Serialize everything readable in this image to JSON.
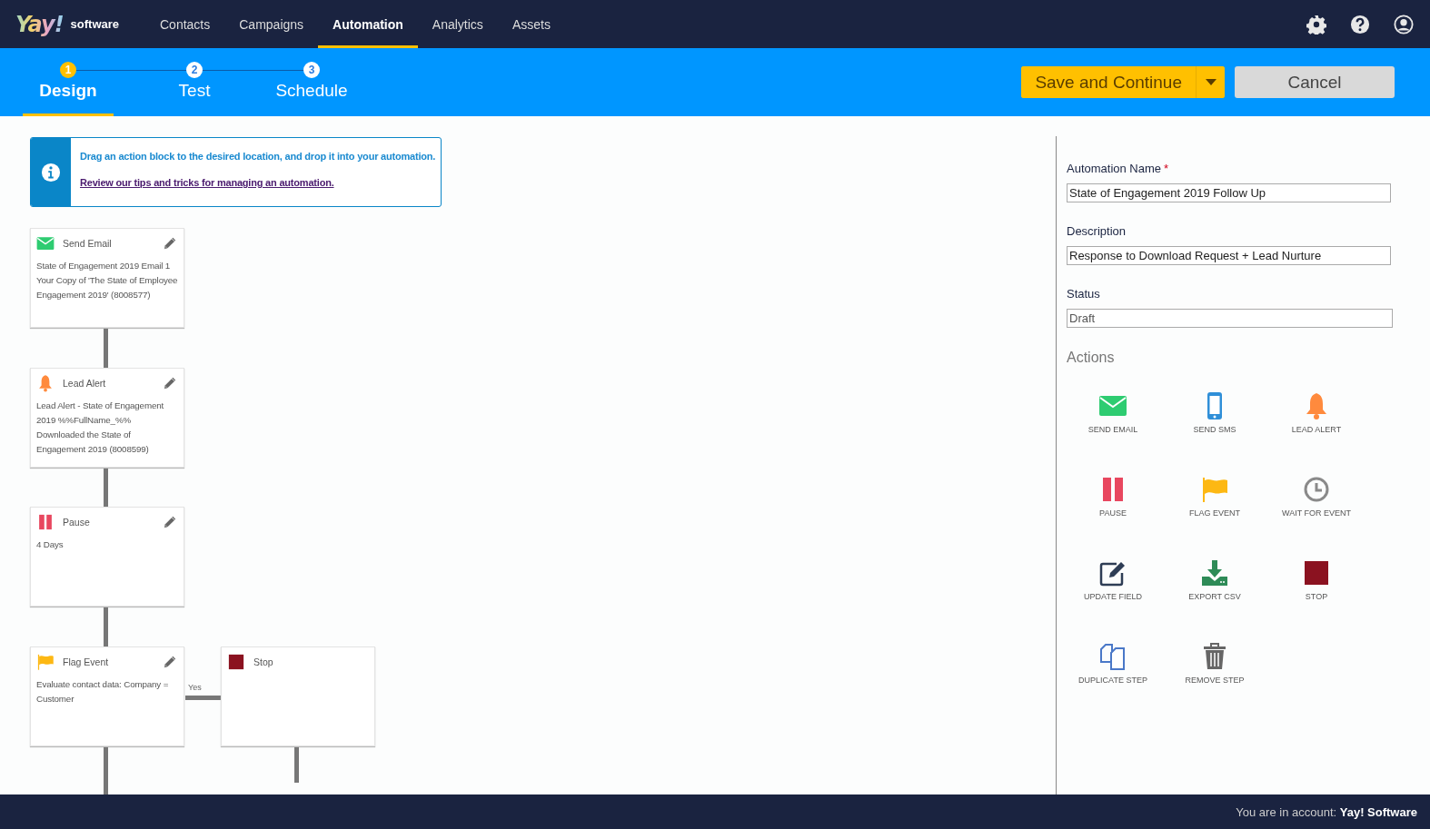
{
  "header": {
    "logo": "Yay!",
    "logo_suffix": "software",
    "nav": [
      {
        "label": "Contacts",
        "selected": false
      },
      {
        "label": "Campaigns",
        "selected": false
      },
      {
        "label": "Automation",
        "selected": true
      },
      {
        "label": "Analytics",
        "selected": false
      },
      {
        "label": "Assets",
        "selected": false
      }
    ]
  },
  "wizard": {
    "steps": [
      {
        "number": "1",
        "label": "Design",
        "selected": true
      },
      {
        "number": "2",
        "label": "Test",
        "selected": false
      },
      {
        "number": "3",
        "label": "Schedule",
        "selected": false
      }
    ],
    "primary_button": "Save and Continue",
    "cancel_button": "Cancel"
  },
  "info": {
    "message": "Drag an action block to the desired location, and drop it into your automation.",
    "link": "Review our tips and tricks for managing an automation."
  },
  "flow": [
    {
      "kind": "email",
      "title": "Send Email",
      "editable": true,
      "text": "State of Engagement 2019 Email 1 Your Copy of 'The State of Employee Engagement 2019' (8008577)"
    },
    {
      "kind": "alert",
      "title": "Lead Alert",
      "editable": true,
      "text": "Lead Alert - State of Engagement 2019 %%FullName_%% Downloaded the State of Engagement 2019 (8008599)"
    },
    {
      "kind": "pause",
      "title": "Pause",
      "editable": true,
      "text": "4 Days"
    },
    {
      "kind": "flag",
      "title": "Flag Event",
      "editable": true,
      "text": "Evaluate contact data: Company = Customer",
      "branch": {
        "label": "Yes",
        "step": {
          "kind": "stop",
          "title": "Stop",
          "editable": false
        }
      }
    }
  ],
  "settings": {
    "fields": [
      {
        "label": "Automation Name",
        "required_mark": "*",
        "value": "State of Engagement 2019 Follow Up",
        "disabled": false
      },
      {
        "label": "Description",
        "value": "Response to Download Request + Lead Nurture",
        "disabled": false
      },
      {
        "label": "Status",
        "value": "Draft",
        "disabled": true
      }
    ],
    "actions_title": "Actions",
    "actions": [
      {
        "kind": "email",
        "label": "SEND EMAIL"
      },
      {
        "kind": "sms",
        "label": "SEND SMS"
      },
      {
        "kind": "alert",
        "label": "LEAD ALERT"
      },
      {
        "kind": "pause",
        "label": "PAUSE"
      },
      {
        "kind": "flag",
        "label": "FLAG EVENT"
      },
      {
        "kind": "wait",
        "label": "WAIT FOR EVENT"
      },
      {
        "kind": "update",
        "label": "UPDATE FIELD"
      },
      {
        "kind": "export",
        "label": "EXPORT CSV"
      },
      {
        "kind": "stop",
        "label": "STOP"
      },
      {
        "kind": "duplicate",
        "label": "DUPLICATE STEP"
      },
      {
        "kind": "remove",
        "label": "REMOVE STEP"
      }
    ]
  },
  "footer": {
    "account": "You are in account: **Yay! Software**"
  }
}
